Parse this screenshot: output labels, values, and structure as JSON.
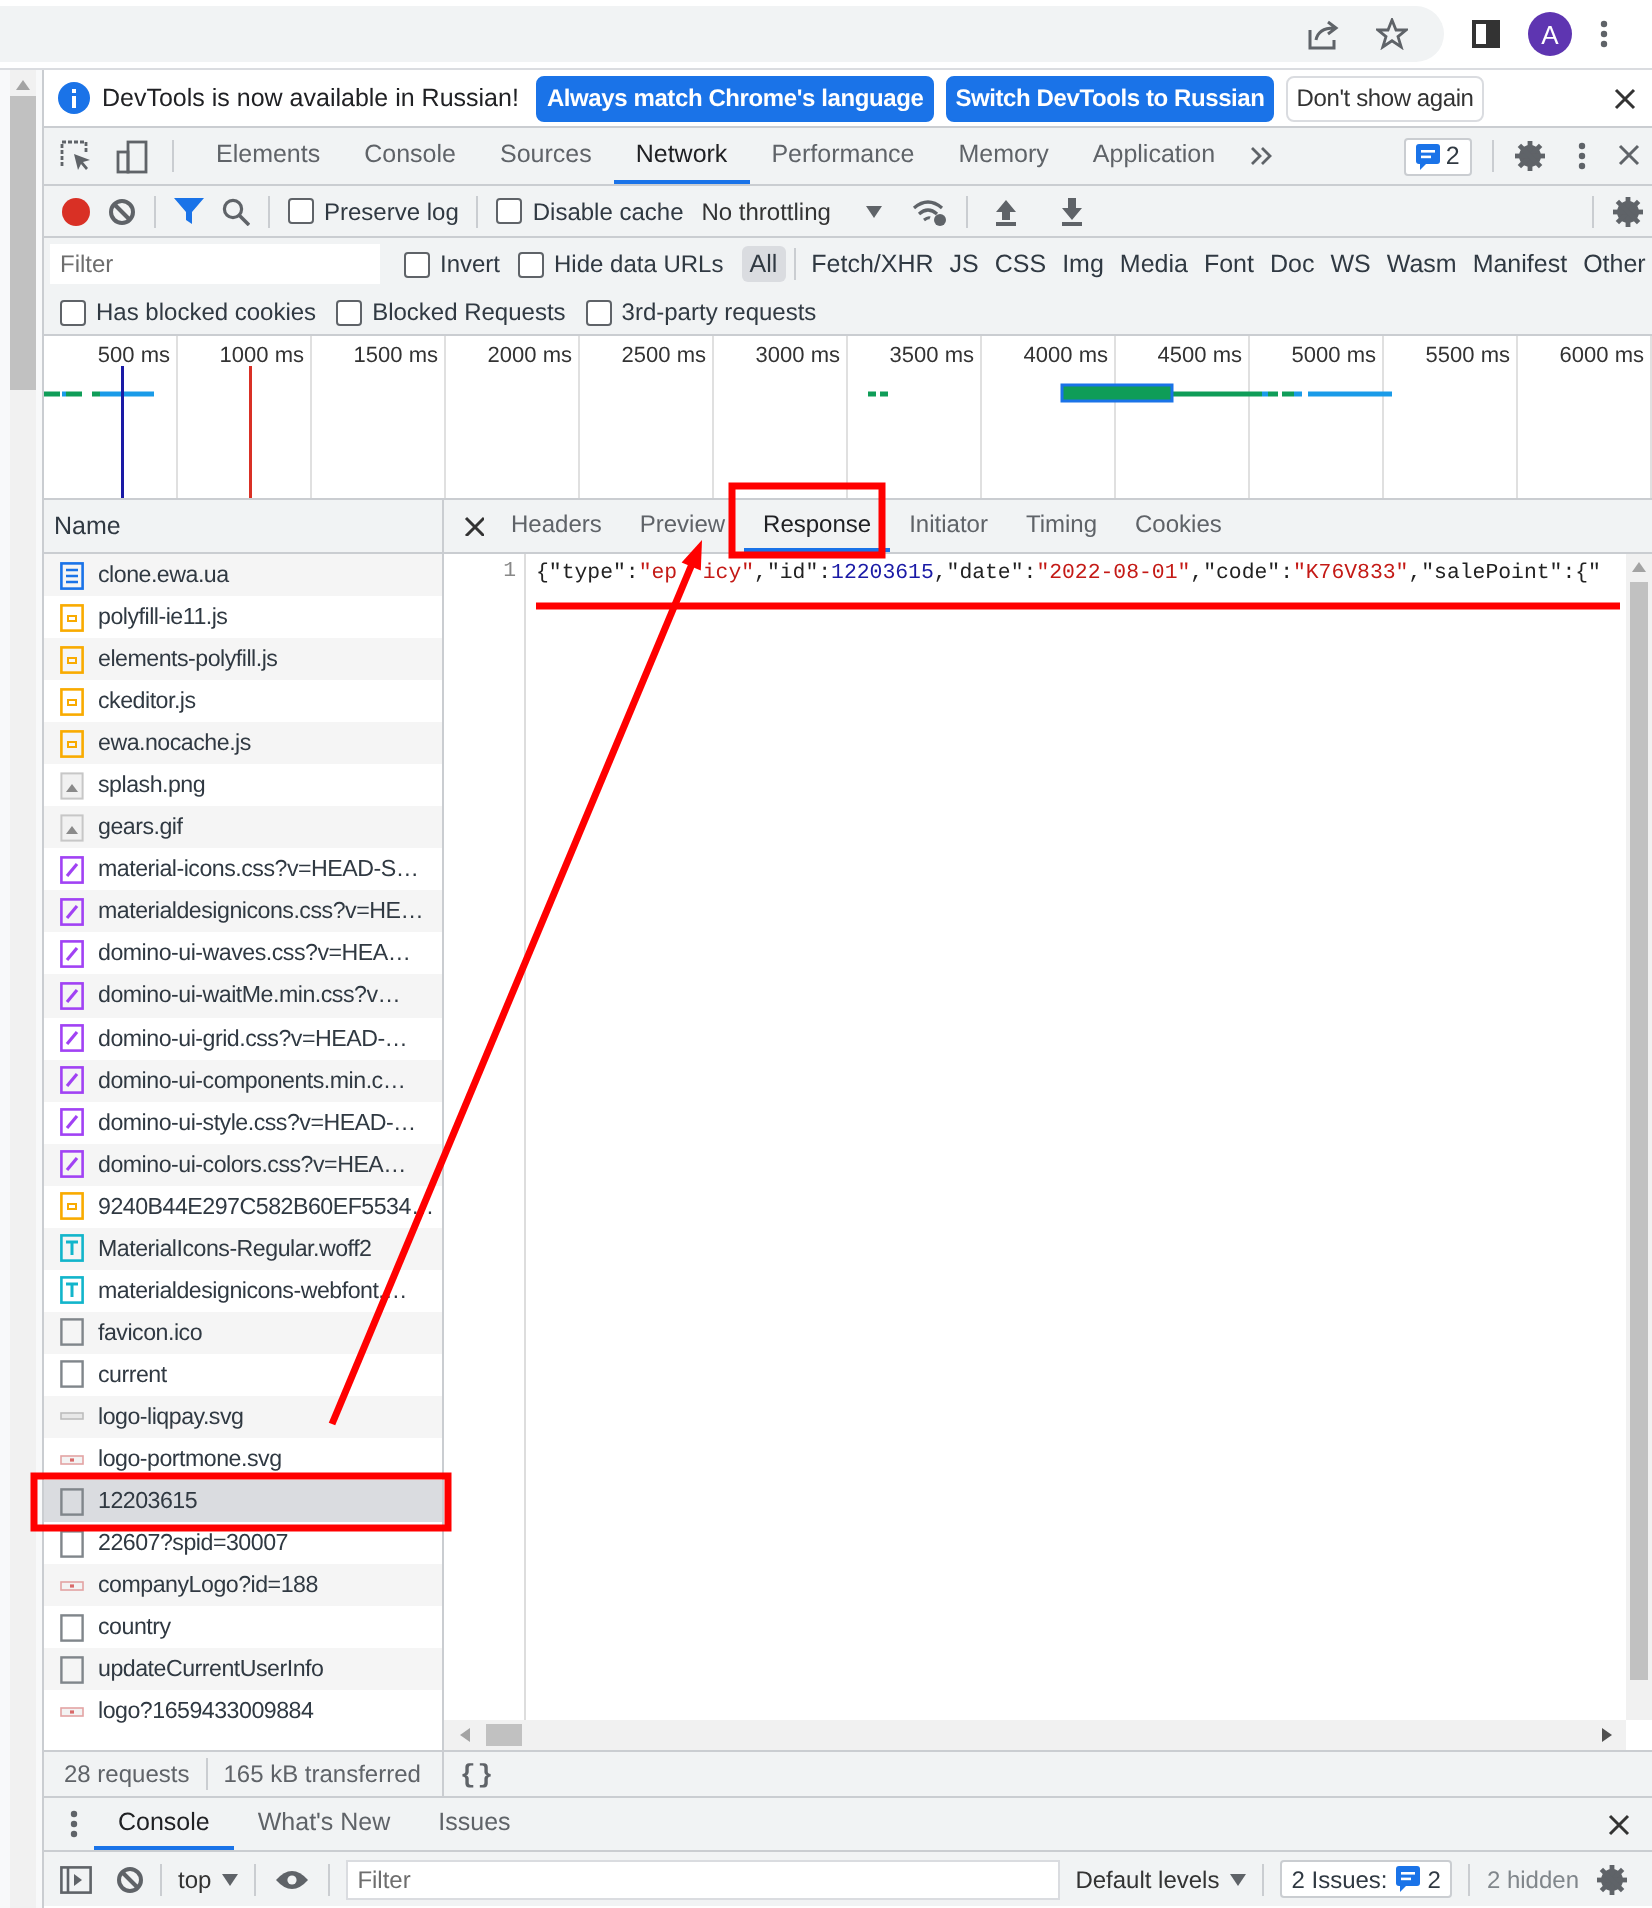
{
  "browser_bar": {
    "avatar": "A"
  },
  "infobar": {
    "message": "DevTools is now available in Russian!",
    "buttons": [
      {
        "label": "Always match Chrome's language",
        "kind": "primary"
      },
      {
        "label": "Switch DevTools to Russian",
        "kind": "primary"
      },
      {
        "label": "Don't show again",
        "kind": "secondary"
      }
    ]
  },
  "main_tabs": [
    {
      "label": "Elements",
      "selected": false
    },
    {
      "label": "Console",
      "selected": false
    },
    {
      "label": "Sources",
      "selected": false
    },
    {
      "label": "Network",
      "selected": true
    },
    {
      "label": "Performance",
      "selected": false
    },
    {
      "label": "Memory",
      "selected": false
    },
    {
      "label": "Application",
      "selected": false
    }
  ],
  "issues_count": "2",
  "network_toolbar": {
    "checkboxes": [
      {
        "label": "Preserve log",
        "checked": false
      },
      {
        "label": "Disable cache",
        "checked": false
      }
    ],
    "throttling": "No throttling"
  },
  "filter_bar": {
    "placeholder": "Filter",
    "checkboxes": [
      {
        "label": "Invert",
        "checked": false
      },
      {
        "label": "Hide data URLs",
        "checked": false
      }
    ],
    "types": [
      {
        "label": "All",
        "selected": true
      },
      {
        "label": "Fetch/XHR",
        "selected": false
      },
      {
        "label": "JS",
        "selected": false
      },
      {
        "label": "CSS",
        "selected": false
      },
      {
        "label": "Img",
        "selected": false
      },
      {
        "label": "Media",
        "selected": false
      },
      {
        "label": "Font",
        "selected": false
      },
      {
        "label": "Doc",
        "selected": false
      },
      {
        "label": "WS",
        "selected": false
      },
      {
        "label": "Wasm",
        "selected": false
      },
      {
        "label": "Manifest",
        "selected": false
      },
      {
        "label": "Other",
        "selected": false
      }
    ]
  },
  "blocked_filters": [
    {
      "label": "Has blocked cookies",
      "checked": false
    },
    {
      "label": "Blocked Requests",
      "checked": false
    },
    {
      "label": "3rd-party requests",
      "checked": false
    }
  ],
  "timeline": {
    "ticks": [
      "500 ms",
      "1000 ms",
      "1500 ms",
      "2000 ms",
      "2500 ms",
      "3000 ms",
      "3500 ms",
      "4000 ms",
      "4500 ms",
      "5000 ms",
      "5500 ms",
      "6000 ms"
    ]
  },
  "requests": {
    "header": "Name",
    "rows": [
      {
        "name": "clone.ewa.ua",
        "kind": "document",
        "selected": false
      },
      {
        "name": "polyfill-ie11.js",
        "kind": "script",
        "selected": false
      },
      {
        "name": "elements-polyfill.js",
        "kind": "script",
        "selected": false
      },
      {
        "name": "ckeditor.js",
        "kind": "script",
        "selected": false
      },
      {
        "name": "ewa.nocache.js",
        "kind": "script",
        "selected": false
      },
      {
        "name": "splash.png",
        "kind": "image",
        "selected": false
      },
      {
        "name": "gears.gif",
        "kind": "image",
        "selected": false
      },
      {
        "name": "material-icons.css?v=HEAD-S…",
        "kind": "stylesheet",
        "selected": false
      },
      {
        "name": "materialdesignicons.css?v=HE…",
        "kind": "stylesheet",
        "selected": false
      },
      {
        "name": "domino-ui-waves.css?v=HEA…",
        "kind": "stylesheet",
        "selected": false
      },
      {
        "name": "domino-ui-waitMe.min.css?v…",
        "kind": "stylesheet",
        "selected": false
      },
      {
        "name": "domino-ui-grid.css?v=HEAD-…",
        "kind": "stylesheet",
        "selected": false
      },
      {
        "name": "domino-ui-components.min.c…",
        "kind": "stylesheet",
        "selected": false
      },
      {
        "name": "domino-ui-style.css?v=HEAD-…",
        "kind": "stylesheet",
        "selected": false
      },
      {
        "name": "domino-ui-colors.css?v=HEA…",
        "kind": "stylesheet",
        "selected": false
      },
      {
        "name": "9240B44E297C582B60EF5534…",
        "kind": "script",
        "selected": false
      },
      {
        "name": "MaterialIcons-Regular.woff2",
        "kind": "font",
        "selected": false
      },
      {
        "name": "materialdesignicons-webfont.…",
        "kind": "font",
        "selected": false
      },
      {
        "name": "favicon.ico",
        "kind": "other",
        "selected": false
      },
      {
        "name": "current",
        "kind": "other",
        "selected": false
      },
      {
        "name": "logo-liqpay.svg",
        "kind": "vector",
        "selected": false
      },
      {
        "name": "logo-portmone.svg",
        "kind": "thumbnail",
        "selected": false
      },
      {
        "name": "12203615",
        "kind": "other",
        "selected": true
      },
      {
        "name": "22607?spid=30007",
        "kind": "other",
        "selected": false
      },
      {
        "name": "companyLogo?id=188",
        "kind": "thumbnail",
        "selected": false
      },
      {
        "name": "country",
        "kind": "other",
        "selected": false
      },
      {
        "name": "updateCurrentUserInfo",
        "kind": "other",
        "selected": false
      },
      {
        "name": "logo?1659433009884",
        "kind": "thumbnail",
        "selected": false
      }
    ]
  },
  "status": {
    "requests": "28 requests",
    "transferred": "165 kB transferred"
  },
  "detail_tabs": [
    {
      "label": "Headers",
      "selected": false
    },
    {
      "label": "Preview",
      "selected": false
    },
    {
      "label": "Response",
      "selected": true
    },
    {
      "label": "Initiator",
      "selected": false
    },
    {
      "label": "Timing",
      "selected": false
    },
    {
      "label": "Cookies",
      "selected": false
    }
  ],
  "response": {
    "line_number": "1",
    "tokens": [
      {
        "text": "{",
        "kind": "plain"
      },
      {
        "text": "\"type\"",
        "kind": "plain"
      },
      {
        "text": ":",
        "kind": "plain"
      },
      {
        "text": "\"ep",
        "kind": "string"
      },
      {
        "kind": "covered"
      },
      {
        "text": "icy\"",
        "kind": "string"
      },
      {
        "text": ",",
        "kind": "plain"
      },
      {
        "text": "\"id\"",
        "kind": "plain"
      },
      {
        "text": ":",
        "kind": "plain"
      },
      {
        "text": "12203615",
        "kind": "number"
      },
      {
        "text": ",",
        "kind": "plain"
      },
      {
        "text": "\"date\"",
        "kind": "plain"
      },
      {
        "text": ":",
        "kind": "plain"
      },
      {
        "text": "\"2022-08-01\"",
        "kind": "string"
      },
      {
        "text": ",",
        "kind": "plain"
      },
      {
        "text": "\"code\"",
        "kind": "plain"
      },
      {
        "text": ":",
        "kind": "plain"
      },
      {
        "text": "\"K76V833\"",
        "kind": "string"
      },
      {
        "text": ",",
        "kind": "plain"
      },
      {
        "text": "\"salePoint\"",
        "kind": "plain"
      },
      {
        "text": ":{\"",
        "kind": "plain"
      }
    ]
  },
  "format_button": "{}",
  "drawer_tabs": [
    {
      "label": "Console",
      "selected": true
    },
    {
      "label": "What's New",
      "selected": false
    },
    {
      "label": "Issues",
      "selected": false
    }
  ],
  "console_toolbar": {
    "context": "top",
    "placeholder": "Filter",
    "levels": "Default levels",
    "issues_label": "2 Issues:",
    "issues_count": "2",
    "hidden": "2 hidden"
  },
  "annotations": [
    {
      "kind": "box"
    },
    {
      "kind": "arrow"
    },
    {
      "kind": "box"
    },
    {
      "kind": "underline"
    }
  ]
}
